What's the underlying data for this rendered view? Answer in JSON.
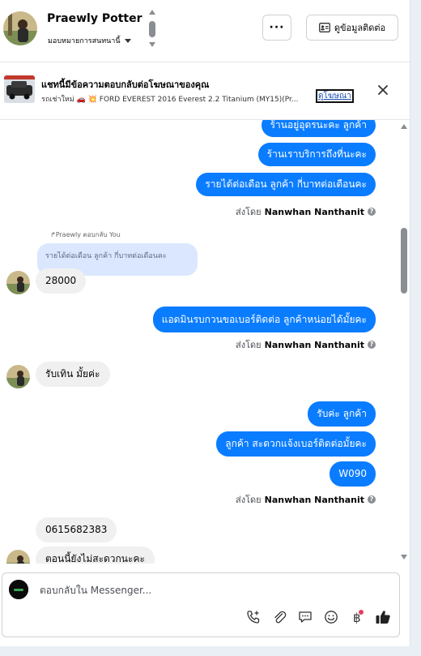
{
  "header": {
    "name": "Praewly Potter",
    "assignee_label": "มอบหมายการสนทนานี้",
    "more_label": "···",
    "contact_button_label": "ดูข้อมูลติดต่อ"
  },
  "ad_banner": {
    "title": "แชทนี้มีข้อความตอบกลับต่อโฆษณาของคุณ",
    "subtitle": "รถเช่าใหม่ 🚗 💥 FORD EVEREST 2016 Everest 2.2 Titanium (MY15)(Pr...",
    "link_label": "ดูโฆษณา"
  },
  "conversation": {
    "sent_by_prefix": "ส่งโดย",
    "agent_name": "Nanwhan Nanthanit",
    "outgoing_group_1": [
      "ร้านอยู่อุดรนะคะ  ลูกค้า",
      "ร้านเราบริการถึงที่นะคะ",
      "รายได้ต่อเดือน  ลูกค้า กี่บาทต่อเดือนคะ"
    ],
    "reply_label": "Praewly ตอบกลับ You",
    "reply_quote": "รายได้ต่อเดือน ลูกค้า กี่บาทต่อเดือนคะ",
    "incoming_1": "28000",
    "outgoing_2": "แอดมินรบกวนขอเบอร์ติดต่อ ลูกค้าหน่อยได้มั้ยคะ",
    "incoming_2": "รับเทิน มั้ยค่ะ",
    "outgoing_group_3": [
      "รับค่ะ  ลูกค้า",
      "ลูกค้า สะดวกแจ้งเบอร์ติดต่อมั้ยคะ",
      "W090"
    ],
    "incoming_3": "0615682383",
    "incoming_4": "ตอนนี้ยังไม่สะดวกนะคะ"
  },
  "composer": {
    "placeholder": "ตอบกลับใน Messenger..."
  },
  "colors": {
    "outgoing_bubble": "#0a7cff",
    "incoming_bubble": "#f0f0f0",
    "reply_quote": "#dbe7ff"
  },
  "icons": [
    "chevron-down-icon",
    "more-icon",
    "contact-card-icon",
    "close-icon",
    "help-icon",
    "phone-add-icon",
    "paperclip-icon",
    "chat-bubble-icon",
    "emoji-icon",
    "baht-icon",
    "thumbs-up-icon"
  ]
}
